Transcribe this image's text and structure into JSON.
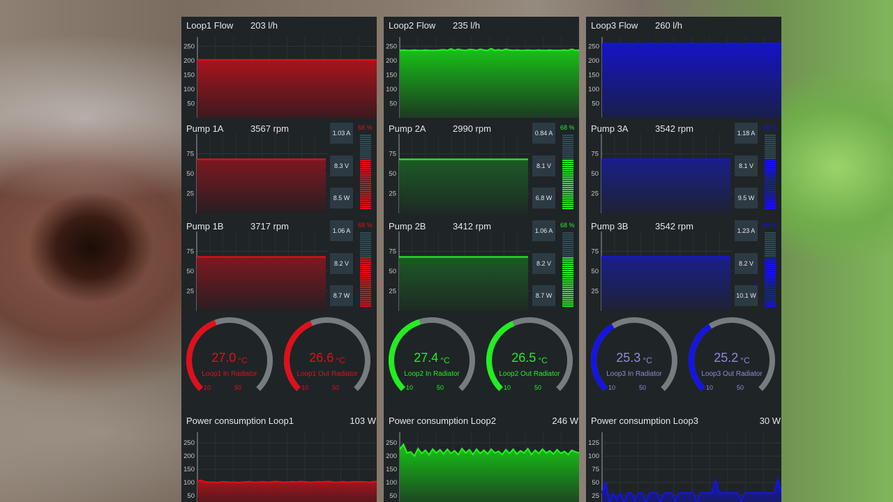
{
  "panels": [
    {
      "id": "loop1",
      "color": "#e0101a",
      "fill_top": "#a8141c",
      "fill_bottom": "#3c1a1e",
      "pump_fill_top": "#7e1820",
      "pump_fill_bottom": "#281e22",
      "gauge_text_color": "#e0101a",
      "flow": {
        "label": "Loop1 Flow",
        "value": "203 l/h",
        "ticks": [
          "250",
          "200",
          "150",
          "100",
          "50"
        ],
        "series": [
          203,
          203,
          203,
          203,
          203,
          203,
          203,
          203,
          203,
          203,
          203,
          203,
          203,
          203,
          203,
          203,
          203,
          203,
          203,
          203,
          203,
          203,
          203,
          203,
          203,
          203,
          203,
          203,
          203,
          203,
          203,
          203,
          203,
          203,
          203,
          203,
          203,
          203,
          203,
          203,
          203,
          203,
          203,
          203,
          203,
          203,
          203,
          203,
          203,
          203
        ]
      },
      "pumps": [
        {
          "label": "Pump 1A",
          "rpm": "3567 rpm",
          "ticks": [
            "75",
            "50",
            "25"
          ],
          "level": 68,
          "amps": "1.03 A",
          "volts": "8.3 V",
          "watts": "8.5 W",
          "pct": "68 %"
        },
        {
          "label": "Pump 1B",
          "rpm": "3717 rpm",
          "ticks": [
            "75",
            "50",
            "25"
          ],
          "level": 68,
          "amps": "1.06 A",
          "volts": "8.2 V",
          "watts": "8.7 W",
          "pct": "68 %"
        }
      ],
      "gauges": [
        {
          "value": "27.0",
          "unit": "°C",
          "label": "Loop1 In Radiator",
          "min_label": "10",
          "max_label": "50",
          "temperature": 27.0
        },
        {
          "value": "26.6",
          "unit": "°C",
          "label": "Loop1 Out Radiator",
          "min_label": "10",
          "max_label": "50",
          "temperature": 26.6
        }
      ],
      "power": {
        "label": "Power consumption Loop1",
        "value": "103 W",
        "ticks": [
          "250",
          "200",
          "150",
          "100",
          "50"
        ],
        "series": [
          106,
          108,
          103,
          101,
          102,
          100,
          101,
          103,
          102,
          101,
          102,
          100,
          101,
          102,
          103,
          102,
          101,
          102,
          103,
          101,
          102,
          104,
          103,
          102,
          101,
          102,
          103,
          102,
          104,
          103,
          102,
          101,
          102,
          103,
          102,
          103,
          104,
          102,
          101,
          102,
          103,
          101,
          102,
          103,
          102,
          103,
          102,
          101,
          103,
          103
        ]
      }
    },
    {
      "id": "loop2",
      "color": "#22ee22",
      "fill_top": "#16c316",
      "fill_bottom": "#1d3a22",
      "pump_fill_top": "#1c5a26",
      "pump_fill_bottom": "#1e2a24",
      "gauge_text_color": "#22ee22",
      "flow": {
        "label": "Loop2 Flow",
        "value": "235 l/h",
        "ticks": [
          "250",
          "200",
          "150",
          "100",
          "50"
        ],
        "series": [
          236,
          237,
          236,
          236,
          237,
          236,
          236,
          237,
          236,
          236,
          236,
          237,
          238,
          236,
          241,
          236,
          240,
          237,
          236,
          239,
          238,
          236,
          240,
          237,
          236,
          242,
          236,
          238,
          236,
          240,
          237,
          236,
          237,
          236,
          236,
          237,
          236,
          236,
          237,
          236,
          236,
          237,
          236,
          236,
          236,
          237,
          236,
          240,
          236,
          237
        ]
      },
      "pumps": [
        {
          "label": "Pump 2A",
          "rpm": "2990 rpm",
          "ticks": [
            "75",
            "50",
            "25"
          ],
          "level": 68,
          "amps": "0.84 A",
          "volts": "8.1 V",
          "watts": "6.8 W",
          "pct": "68 %"
        },
        {
          "label": "Pump 2B",
          "rpm": "3412 rpm",
          "ticks": [
            "75",
            "50",
            "25"
          ],
          "level": 68,
          "amps": "1.06 A",
          "volts": "8.2 V",
          "watts": "8.7 W",
          "pct": "68 %"
        }
      ],
      "gauges": [
        {
          "value": "27.4",
          "unit": "°C",
          "label": "Loop2 In Radiator",
          "min_label": "10",
          "max_label": "50",
          "temperature": 27.4
        },
        {
          "value": "26.5",
          "unit": "°C",
          "label": "Loop2 Out Radiator",
          "min_label": "10",
          "max_label": "50",
          "temperature": 26.5
        }
      ],
      "power": {
        "label": "Power consumption Loop2",
        "value": "246 W",
        "ticks": [
          "250",
          "200",
          "150",
          "100",
          "50"
        ],
        "series": [
          225,
          244,
          212,
          216,
          200,
          228,
          210,
          222,
          205,
          226,
          212,
          224,
          208,
          226,
          210,
          220,
          205,
          228,
          212,
          224,
          206,
          226,
          210,
          222,
          208,
          226,
          212,
          218,
          206,
          224,
          210,
          226,
          208,
          220,
          212,
          228,
          206,
          222,
          210,
          226,
          212,
          220,
          208,
          224,
          210,
          218,
          206,
          222,
          216,
          212
        ]
      }
    },
    {
      "id": "loop3",
      "color": "#1414e6",
      "fill_top": "#1414c8",
      "fill_bottom": "#1a1e4a",
      "pump_fill_top": "#1a1e8a",
      "pump_fill_bottom": "#1e2234",
      "gauge_text_color": "#8c8cd6",
      "flow": {
        "label": "Loop3 Flow",
        "value": "260 l/h",
        "ticks": [
          "250",
          "200",
          "150",
          "100",
          "50"
        ],
        "series": [
          258,
          260,
          259,
          260,
          260,
          259,
          261,
          260,
          259,
          260,
          260,
          259,
          260,
          261,
          260,
          259,
          260,
          260,
          261,
          259,
          260,
          260,
          259,
          260,
          261,
          260,
          259,
          260,
          260,
          259,
          260,
          261,
          260,
          259,
          260,
          260,
          261,
          260,
          259,
          260,
          260,
          261,
          260,
          259,
          260,
          261,
          260,
          260,
          259,
          263
        ]
      },
      "pumps": [
        {
          "label": "Pump 3A",
          "rpm": "3542 rpm",
          "ticks": [
            "75",
            "50",
            "25"
          ],
          "level": 68,
          "amps": "1.18 A",
          "volts": "8.1 V",
          "watts": "9.5 W",
          "pct": "68 %"
        },
        {
          "label": "Pump 3B",
          "rpm": "3542 rpm",
          "ticks": [
            "75",
            "50",
            "25"
          ],
          "level": 68,
          "amps": "1.23 A",
          "volts": "8.2 V",
          "watts": "10.1 W",
          "pct": "68 %"
        }
      ],
      "gauges": [
        {
          "value": "25.3",
          "unit": "°C",
          "label": "Loop3 In Radiator",
          "min_label": "10",
          "max_label": "50",
          "temperature": 25.3
        },
        {
          "value": "25.2",
          "unit": "°C",
          "label": "Loop3 Out Radiator",
          "min_label": "10",
          "max_label": "50",
          "temperature": 25.2
        }
      ],
      "power": {
        "label": "Power consumption Loop3",
        "value": "30 W",
        "ticks": [
          "125",
          "100",
          "75",
          "50",
          "25"
        ],
        "series": [
          30,
          52,
          10,
          30,
          18,
          30,
          12,
          30,
          30,
          16,
          30,
          30,
          12,
          30,
          30,
          30,
          14,
          30,
          30,
          30,
          16,
          30,
          30,
          30,
          30,
          30,
          12,
          30,
          30,
          30,
          30,
          54,
          30,
          30,
          30,
          30,
          30,
          30,
          14,
          30,
          30,
          30,
          30,
          30,
          30,
          30,
          30,
          30,
          56,
          30
        ]
      }
    }
  ]
}
